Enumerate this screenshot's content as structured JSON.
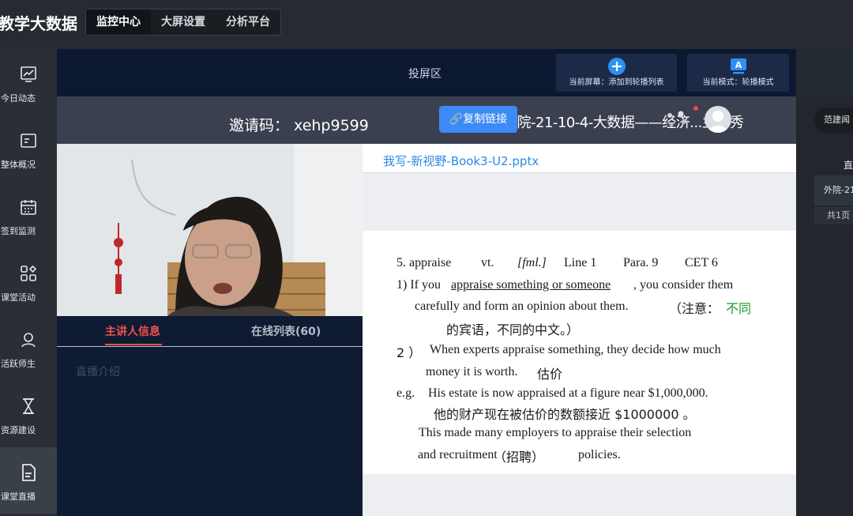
{
  "app": {
    "title": "教学大数据"
  },
  "topnav": {
    "tabs": [
      "监控中心",
      "大屏设置",
      "分析平台"
    ]
  },
  "sidebar": {
    "items": [
      {
        "label": "今日动态",
        "icon": "trend-chart-icon"
      },
      {
        "label": "整体概况",
        "icon": "overview-icon"
      },
      {
        "label": "签到监测",
        "icon": "calendar-icon"
      },
      {
        "label": "课堂活动",
        "icon": "grid-apps-icon"
      },
      {
        "label": "活跃师生",
        "icon": "user-icon"
      },
      {
        "label": "资源建设",
        "icon": "hourglass-icon"
      },
      {
        "label": "课堂直播",
        "icon": "document-icon"
      }
    ]
  },
  "stage": {
    "title": "投屏区",
    "add_button": "当前屏幕：添加到轮播列表",
    "mode_button": "当前模式：轮播模式",
    "mode_icon_letter": "A"
  },
  "invite": {
    "code_text": "邀请码： xehp9599",
    "copy_label": "复制链接",
    "course_title": "外院-21-10-4-大数据——经济...兰冬秀"
  },
  "info": {
    "tab_host": "主讲人信息",
    "tab_online": "在线列表(60)",
    "intro_placeholder": "直播介绍"
  },
  "file": {
    "name": "我写-新视野-Book3-U2.pptx"
  },
  "slide": {
    "l1a": "5. appraise",
    "l1b": "vt.",
    "l1c": "[fml.]",
    "l1d": "Line 1",
    "l1e": "Para. 9",
    "l1f": "CET 6",
    "l2a": "1) If you ",
    "l2b": "appraise something or someone",
    "l2c": ", you consider them",
    "l3a": "carefully and form an opinion about them.",
    "l3b": "（注意：",
    "l3c": "不同",
    "l4": "的宾语，不同的中文。）",
    "l5a": "2 ）",
    "l5b": "When experts appraise something, they decide how much",
    "l6a": "money it is worth.",
    "l6b": "估价",
    "l7a": "e.g.",
    "l7b": "His estate is now appraised at a figure near $1,000,000.",
    "l8": "他的财产现在被估价的数额接近 $1000000 。",
    "l9": "This made many employers to appraise their selection",
    "l10a": "and recruitment",
    "l10b": "（招聘）",
    "l10c": "policies."
  },
  "rightpanel": {
    "chip": "范建闻",
    "head": "直",
    "item": "外院-21",
    "pages": "共1页"
  },
  "colors": {
    "accent": "#3d8af7",
    "active_red": "#f0524b",
    "highlight_green": "#1f9a2b",
    "file_link": "#2b8ae8"
  }
}
